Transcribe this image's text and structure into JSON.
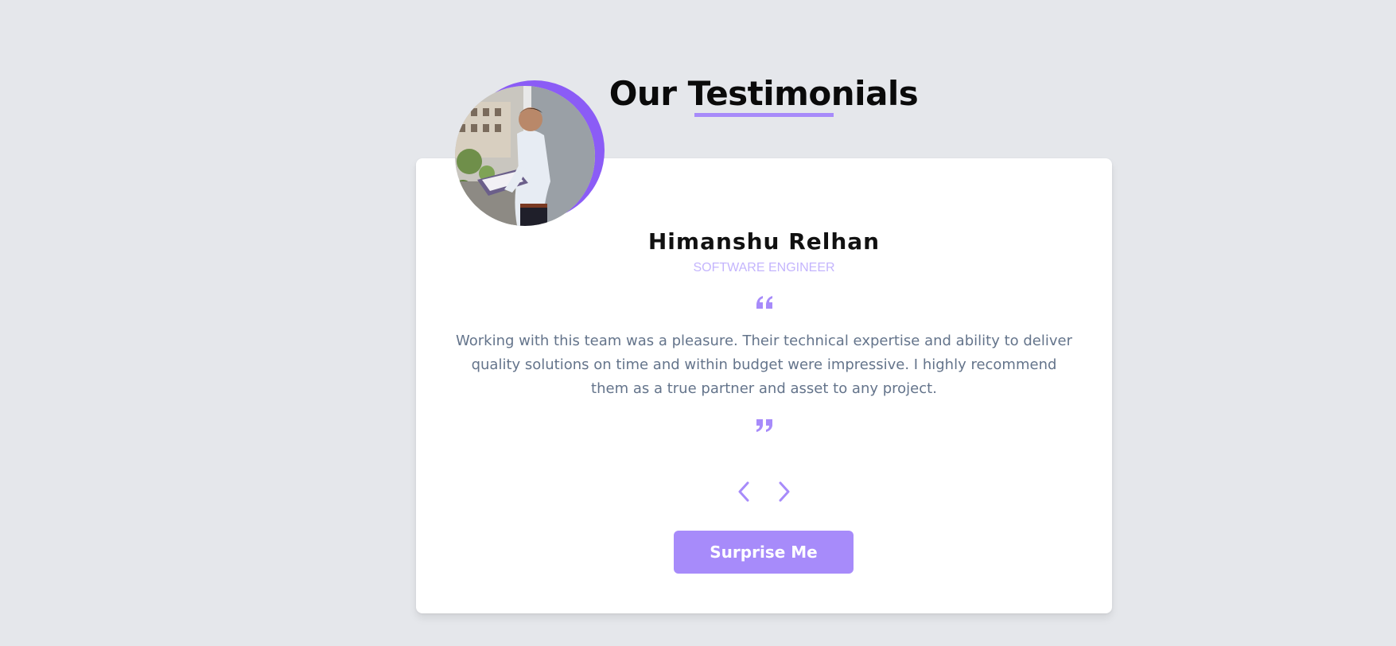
{
  "heading": {
    "title": "Our Testimonials"
  },
  "testimonial": {
    "name": "Himanshu Relhan",
    "role": "SOFTWARE ENGINEER",
    "text": "Working with this team was a pleasure. Their technical expertise and ability to deliver quality solutions on time and within budget were impressive. I highly recommend them as a true partner and asset to any project.",
    "avatar_alt": "Himanshu Relhan photo"
  },
  "controls": {
    "prev_icon": "chevron-left-icon",
    "next_icon": "chevron-right-icon",
    "surprise_label": "Surprise Me"
  },
  "icons": {
    "quote_open": "quote-open-icon",
    "quote_close": "quote-close-icon"
  },
  "colors": {
    "background": "#e5e7eb",
    "accent": "#a78bfa",
    "accent_dark": "#8b5cf6",
    "role_text": "#c4b5fd",
    "body_text": "#64748b",
    "card": "#ffffff"
  }
}
